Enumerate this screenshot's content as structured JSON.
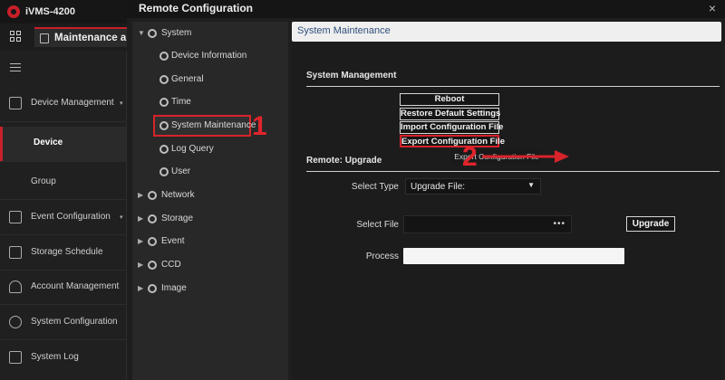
{
  "app": {
    "title": "iVMS-4200",
    "active_tab": "Maintenance a"
  },
  "sidebar": {
    "items": [
      {
        "label": "Device Management",
        "active": false
      },
      {
        "label": "Device",
        "active": true
      },
      {
        "label": "Group",
        "active": false
      },
      {
        "label": "Event Configuration",
        "active": false
      },
      {
        "label": "Storage Schedule",
        "active": false
      },
      {
        "label": "Account Management",
        "active": false
      },
      {
        "label": "System Configuration",
        "active": false
      },
      {
        "label": "System Log",
        "active": false
      }
    ]
  },
  "remote_config": {
    "title": "Remote Configuration",
    "close_glyph": "×",
    "tree": {
      "system": "System",
      "system_children": [
        "Device Information",
        "General",
        "Time",
        "System Maintenance",
        "Log Query",
        "User"
      ],
      "others": [
        "Network",
        "Storage",
        "Event",
        "CCD",
        "Image"
      ]
    },
    "selected_tree_item": "System Maintenance",
    "markers": {
      "step1": "1",
      "step2": "2"
    },
    "content": {
      "header_title": "System Maintenance",
      "system_management_label": "System Management",
      "buttons": {
        "reboot": "Reboot",
        "restore": "Restore Default Settings",
        "import": "Import Configuration File",
        "export": "Export Configuration File"
      },
      "tooltip": "Export Configuration File",
      "upgrade_section_label": "Remote: Upgrade",
      "select_type_label": "Select Type",
      "select_type_value": "Upgrade File:",
      "select_file_label": "Select File",
      "browse_glyph": "•••",
      "upgrade_button": "Upgrade",
      "process_label": "Process",
      "process_progress": 0
    }
  },
  "colors": {
    "accent_red": "#d8232a",
    "header_text_blue": "#2e4f7d"
  }
}
